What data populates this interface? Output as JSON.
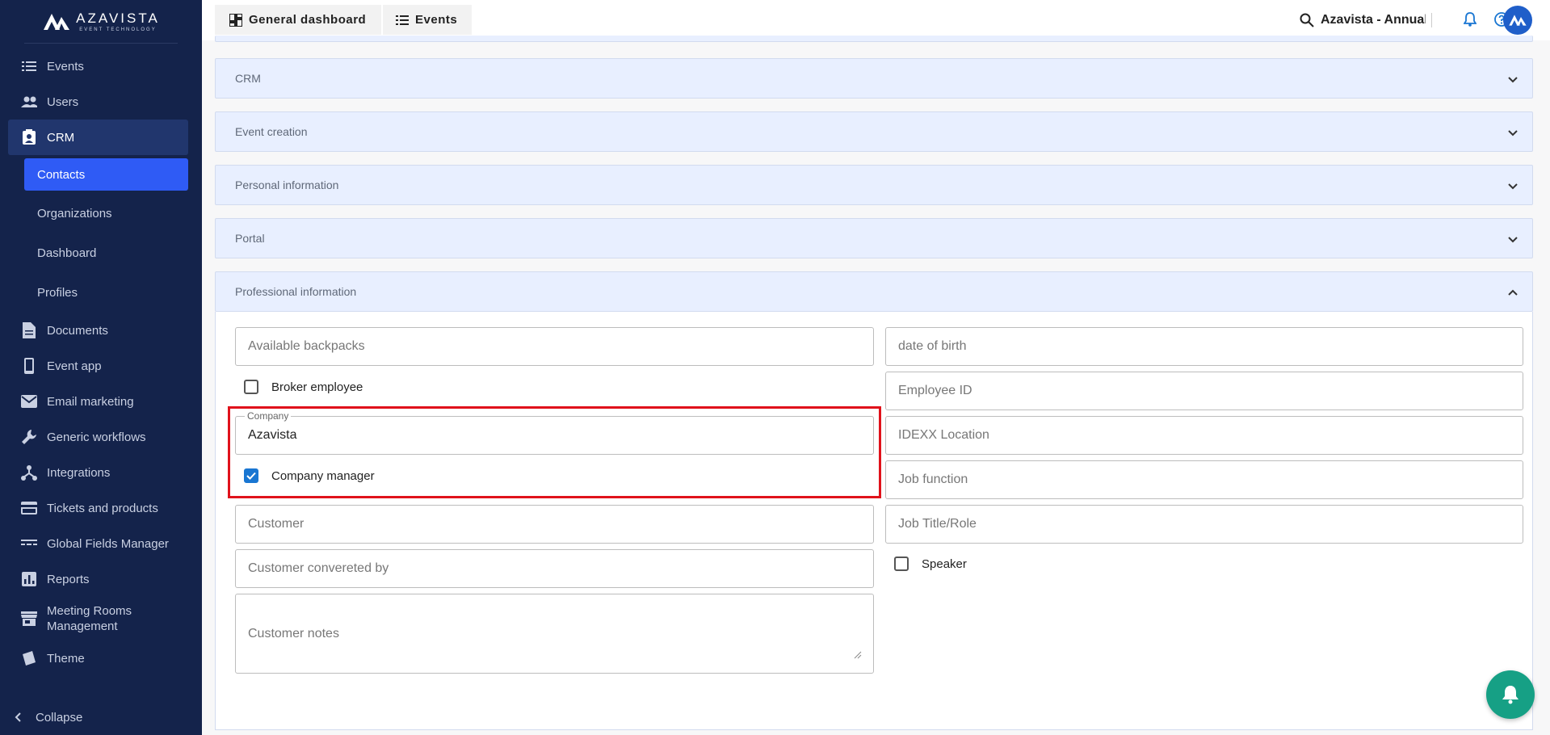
{
  "app": {
    "brand_name": "AZAVISTA",
    "brand_tagline": "EVENT TECHNOLOGY"
  },
  "sidebar": {
    "items": [
      {
        "label": "Events",
        "icon": "list-icon"
      },
      {
        "label": "Users",
        "icon": "users-icon"
      },
      {
        "label": "CRM",
        "icon": "contact-card-icon"
      },
      {
        "label": "Documents",
        "icon": "document-icon"
      },
      {
        "label": "Event app",
        "icon": "phone-icon"
      },
      {
        "label": "Email marketing",
        "icon": "mail-icon"
      },
      {
        "label": "Generic workflows",
        "icon": "wrench-icon"
      },
      {
        "label": "Integrations",
        "icon": "hub-icon"
      },
      {
        "label": "Tickets and products",
        "icon": "card-icon"
      },
      {
        "label": "Global Fields Manager",
        "icon": "fields-icon"
      },
      {
        "label": "Reports",
        "icon": "chart-icon"
      },
      {
        "label": "Meeting Rooms Management",
        "icon": "store-icon"
      },
      {
        "label": "Theme",
        "icon": "theme-icon"
      }
    ],
    "crm_sub": [
      {
        "label": "Contacts"
      },
      {
        "label": "Organizations"
      },
      {
        "label": "Dashboard"
      },
      {
        "label": "Profiles"
      }
    ],
    "collapse_label": "Collapse"
  },
  "topbar": {
    "tab_general": "General dashboard",
    "tab_events": "Events",
    "search_text": "Azavista - Annual"
  },
  "sections": {
    "crm": "CRM",
    "event_creation": "Event creation",
    "personal_information": "Personal information",
    "portal": "Portal",
    "professional_information": "Professional information"
  },
  "form": {
    "available_backpacks": "Available backpacks",
    "broker_employee": "Broker employee",
    "company_label": "Company",
    "company_value": "Azavista",
    "company_manager": "Company manager",
    "customer": "Customer",
    "customer_converted_by": "Customer convereted by",
    "customer_notes": "Customer notes",
    "date_of_birth": "date of birth",
    "employee_id": "Employee ID",
    "idexx_location": "IDEXX Location",
    "job_function": "Job function",
    "job_title_role": "Job Title/Role",
    "speaker": "Speaker",
    "broker_employee_checked": false,
    "company_manager_checked": true,
    "speaker_checked": false
  },
  "colors": {
    "sidebar_bg": "#14234b",
    "accent": "#2f5bf5",
    "section_bg": "#e8efff",
    "highlight": "#e0121b",
    "fab": "#16a085"
  }
}
